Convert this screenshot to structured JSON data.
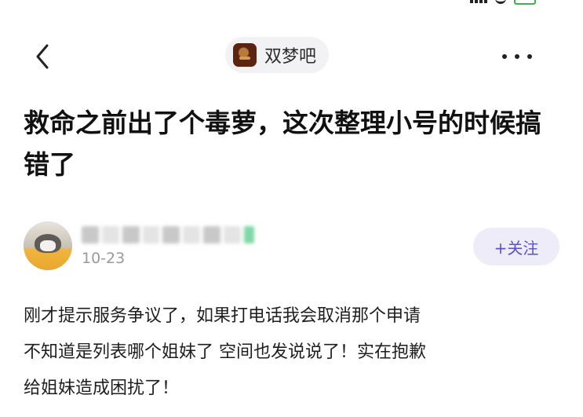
{
  "nav": {
    "forum_name": "双梦吧"
  },
  "post": {
    "title": "救命之前出了个毒萝，这次整理小号的时候搞错了",
    "date": "10-23",
    "body_lines": [
      "刚才提示服务争议了，如果打电话我会取消那个申请",
      "不知道是列表哪个姐妹了 空间也发说说了！实在抱歉",
      "给姐妹造成困扰了！"
    ]
  },
  "author": {
    "follow_label": "+关注"
  },
  "icons": {
    "back": "chevron-left-icon",
    "more": "more-horizontal-icon"
  },
  "colors": {
    "follow_text": "#5a52c8",
    "follow_bg": "#eeecf9",
    "date": "#9a9a9a"
  }
}
